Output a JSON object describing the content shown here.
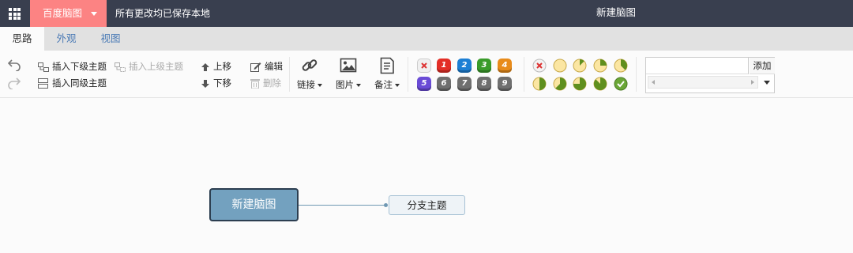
{
  "header": {
    "brand_label": "百度脑图",
    "save_status": "所有更改均已保存本地",
    "doc_title": "新建脑图"
  },
  "tabs": [
    {
      "label": "思路",
      "active": true
    },
    {
      "label": "外观",
      "active": false
    },
    {
      "label": "视图",
      "active": false
    }
  ],
  "toolbar": {
    "insert_child": "插入下级主题",
    "insert_parent": "插入上级主题",
    "insert_sibling": "插入同级主题",
    "move_up": "上移",
    "move_down": "下移",
    "edit": "编辑",
    "delete": "删除",
    "link": "链接",
    "image": "图片",
    "note": "备注"
  },
  "priorities": [
    "1",
    "2",
    "3",
    "4",
    "5",
    "6",
    "7",
    "8",
    "9"
  ],
  "priority_colors": {
    "1": "#e32e26",
    "2": "#1d7fd4",
    "3": "#3a9b2a",
    "4": "#e88b1a",
    "5": "#6a4bd6",
    "6": "#6f6f6f",
    "7": "#6f6f6f",
    "8": "#6f6f6f",
    "9": "#6f6f6f"
  },
  "progress_levels": [
    "none",
    "0",
    "1/8",
    "1/4",
    "3/8",
    "1/2",
    "5/8",
    "3/4",
    "7/8",
    "done"
  ],
  "resource": {
    "add_label": "添加",
    "input_value": ""
  },
  "mindmap": {
    "root": "新建脑图",
    "branch": "分支主题"
  },
  "colors": {
    "topbar": "#393f4f",
    "brand": "#fc8383",
    "tabbar": "#e1e1e1",
    "root_fill": "#73a1bf",
    "root_border": "#2c3e50",
    "branch_fill": "#eef3f7",
    "connector": "#6f98b3"
  }
}
